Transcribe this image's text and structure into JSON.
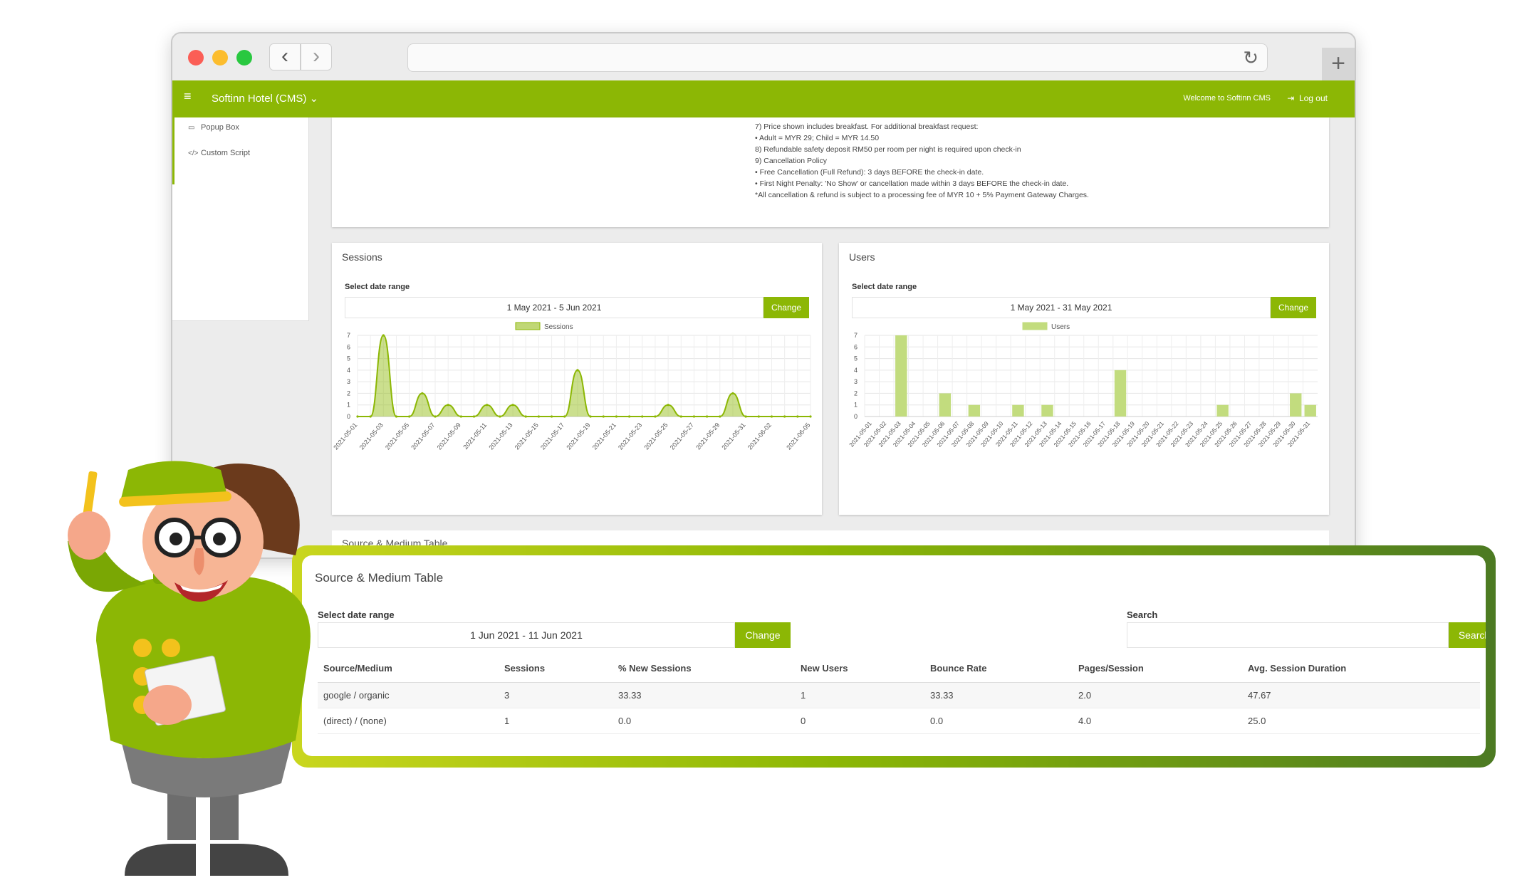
{
  "browser": {
    "back_icon": "chevron-left-icon",
    "forward_icon": "chevron-right-icon",
    "reload_icon": "reload-icon",
    "newtab_icon": "plus-icon"
  },
  "app": {
    "title": "Softinn Hotel (CMS)",
    "welcome": "Welcome to Softinn CMS",
    "logout": "Log out",
    "accent_color": "#8cb705"
  },
  "sidebar": {
    "items": [
      {
        "label": "Popup Box",
        "icon": "window-icon"
      },
      {
        "label": "Custom Script",
        "icon": "code-icon"
      }
    ]
  },
  "policy": {
    "lines": [
      "7) Price shown includes breakfast. For additional breakfast request:",
      "• Adult = MYR 29; Child = MYR 14.50",
      "8) Refundable safety deposit RM50 per room per night is required upon check-in",
      "9) Cancellation Policy",
      "• Free Cancellation (Full Refund): 3 days BEFORE the check-in date.",
      "• First Night Penalty: 'No Show' or cancellation made within 3 days BEFORE the check-in date.",
      "*All cancellation & refund is subject to a processing fee of MYR 10 + 5% Payment Gateway Charges."
    ]
  },
  "sessions_card": {
    "title": "Sessions",
    "date_label": "Select date range",
    "date_range": "1 May 2021 - 5 Jun 2021",
    "change": "Change"
  },
  "users_card": {
    "title": "Users",
    "date_label": "Select date range",
    "date_range": "1 May 2021 - 31 May 2021",
    "change": "Change"
  },
  "source_peek_title": "Source & Medium Table",
  "source_table": {
    "title": "Source & Medium Table",
    "date_label": "Select date range",
    "date_range": "1 Jun 2021 - 11 Jun 2021",
    "change": "Change",
    "search_label": "Search",
    "search_button": "Search",
    "columns": [
      "Source/Medium",
      "Sessions",
      "% New Sessions",
      "New Users",
      "Bounce Rate",
      "Pages/Session",
      "Avg. Session Duration"
    ],
    "rows": [
      [
        "google / organic",
        "3",
        "33.33",
        "1",
        "33.33",
        "2.0",
        "47.67"
      ],
      [
        "(direct) / (none)",
        "1",
        "0.0",
        "0",
        "0.0",
        "4.0",
        "25.0"
      ]
    ]
  },
  "chart_data": [
    {
      "type": "area",
      "legend": "Sessions",
      "x": [
        "2021-05-01",
        "2021-05-02",
        "2021-05-03",
        "2021-05-04",
        "2021-05-05",
        "2021-05-06",
        "2021-05-07",
        "2021-05-08",
        "2021-05-09",
        "2021-05-10",
        "2021-05-11",
        "2021-05-12",
        "2021-05-13",
        "2021-05-14",
        "2021-05-15",
        "2021-05-16",
        "2021-05-17",
        "2021-05-18",
        "2021-05-19",
        "2021-05-20",
        "2021-05-21",
        "2021-05-22",
        "2021-05-23",
        "2021-05-24",
        "2021-05-25",
        "2021-05-26",
        "2021-05-27",
        "2021-05-28",
        "2021-05-29",
        "2021-05-30",
        "2021-05-31",
        "2021-06-01",
        "2021-06-02",
        "2021-06-03",
        "2021-06-04",
        "2021-06-05"
      ],
      "xticks": [
        "2021-05-01",
        "2021-05-03",
        "2021-05-05",
        "2021-05-07",
        "2021-05-09",
        "2021-05-11",
        "2021-05-13",
        "2021-05-15",
        "2021-05-17",
        "2021-05-19",
        "2021-05-21",
        "2021-05-23",
        "2021-05-25",
        "2021-05-27",
        "2021-05-29",
        "2021-05-31",
        "2021-06-02",
        "2021-06-05"
      ],
      "values": [
        0,
        0,
        7,
        0,
        0,
        2,
        0,
        1,
        0,
        0,
        1,
        0,
        1,
        0,
        0,
        0,
        0,
        4,
        0,
        0,
        0,
        0,
        0,
        0,
        1,
        0,
        0,
        0,
        0,
        2,
        0,
        0,
        0,
        0,
        0,
        0
      ],
      "ylim": [
        0,
        7
      ],
      "yticks": [
        0,
        1,
        2,
        3,
        4,
        5,
        6,
        7
      ],
      "color": "#8cb705",
      "grid": true,
      "legend_position": "top-center"
    },
    {
      "type": "bar",
      "legend": "Users",
      "categories": [
        "2021-05-01",
        "2021-05-02",
        "2021-05-03",
        "2021-05-04",
        "2021-05-05",
        "2021-05-06",
        "2021-05-07",
        "2021-05-08",
        "2021-05-09",
        "2021-05-10",
        "2021-05-11",
        "2021-05-12",
        "2021-05-13",
        "2021-05-14",
        "2021-05-15",
        "2021-05-16",
        "2021-05-17",
        "2021-05-18",
        "2021-05-19",
        "2021-05-20",
        "2021-05-21",
        "2021-05-22",
        "2021-05-23",
        "2021-05-24",
        "2021-05-25",
        "2021-05-26",
        "2021-05-27",
        "2021-05-28",
        "2021-05-29",
        "2021-05-30",
        "2021-05-31"
      ],
      "values": [
        0,
        0,
        7,
        0,
        0,
        2,
        0,
        1,
        0,
        0,
        1,
        0,
        1,
        0,
        0,
        0,
        0,
        4,
        0,
        0,
        0,
        0,
        0,
        0,
        1,
        0,
        0,
        0,
        0,
        2,
        1
      ],
      "ylim": [
        0,
        7
      ],
      "yticks": [
        0,
        1,
        2,
        3,
        4,
        5,
        6,
        7
      ],
      "color": "#c2dc7e",
      "grid": true,
      "legend_position": "top-center"
    }
  ]
}
